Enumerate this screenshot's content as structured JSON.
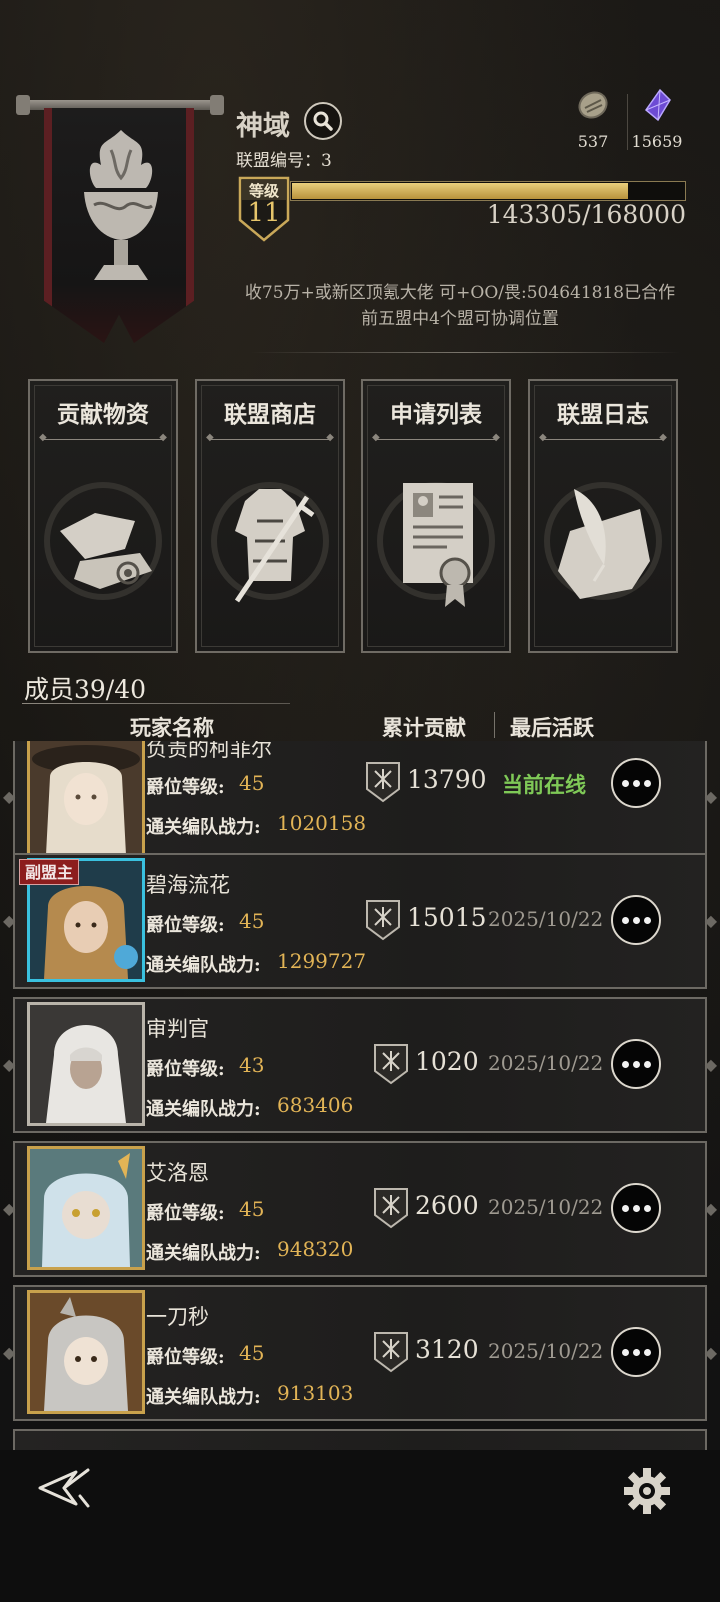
{
  "header": {
    "alliance_name": "神域",
    "alliance_id_text": "联盟编号：3",
    "level_label": "等级",
    "level": "11",
    "xp_text": "143305/168000",
    "xp_progress": 0.853,
    "notice": "收75万+或新区顶氪大佬 可+OO/畏:504641818已合作前五盟中4个盟可协调位置"
  },
  "resources": [
    {
      "icon": "stone-coin-icon",
      "value": "537"
    },
    {
      "icon": "purple-crystal-icon",
      "value": "15659"
    }
  ],
  "functions": [
    {
      "label": "贡献物资",
      "icon": "supplies-icon"
    },
    {
      "label": "联盟商店",
      "icon": "armor-shop-icon"
    },
    {
      "label": "申请列表",
      "icon": "application-scroll-icon"
    },
    {
      "label": "联盟日志",
      "icon": "quill-log-icon"
    }
  ],
  "members": {
    "title": "成员39/40",
    "col_player": "玩家名称",
    "col_contribution": "累计贡献",
    "col_last_active": "最后活跃",
    "level_label": "爵位等级:",
    "power_label": "通关编队战力:",
    "rows": [
      {
        "name": "负责的柯菲尔",
        "level": "45",
        "power": "1020158",
        "contribution": "13790",
        "last_active": "当前在线",
        "online": true,
        "role": ""
      },
      {
        "name": "碧海流花",
        "level": "45",
        "power": "1299727",
        "contribution": "15015",
        "last_active": "2025/10/22",
        "online": false,
        "role": "副盟主"
      },
      {
        "name": "审判官",
        "level": "43",
        "power": "683406",
        "contribution": "1020",
        "last_active": "2025/10/22",
        "online": false,
        "role": ""
      },
      {
        "name": "艾洛恩",
        "level": "45",
        "power": "948320",
        "contribution": "2600",
        "last_active": "2025/10/22",
        "online": false,
        "role": ""
      },
      {
        "name": "一刀秒",
        "level": "45",
        "power": "913103",
        "contribution": "3120",
        "last_active": "2025/10/22",
        "online": false,
        "role": ""
      }
    ]
  },
  "colors": {
    "gold_value": "#e2b456",
    "online_green": "#7fc957",
    "vice_leader_tag": "#8c1d1d"
  }
}
